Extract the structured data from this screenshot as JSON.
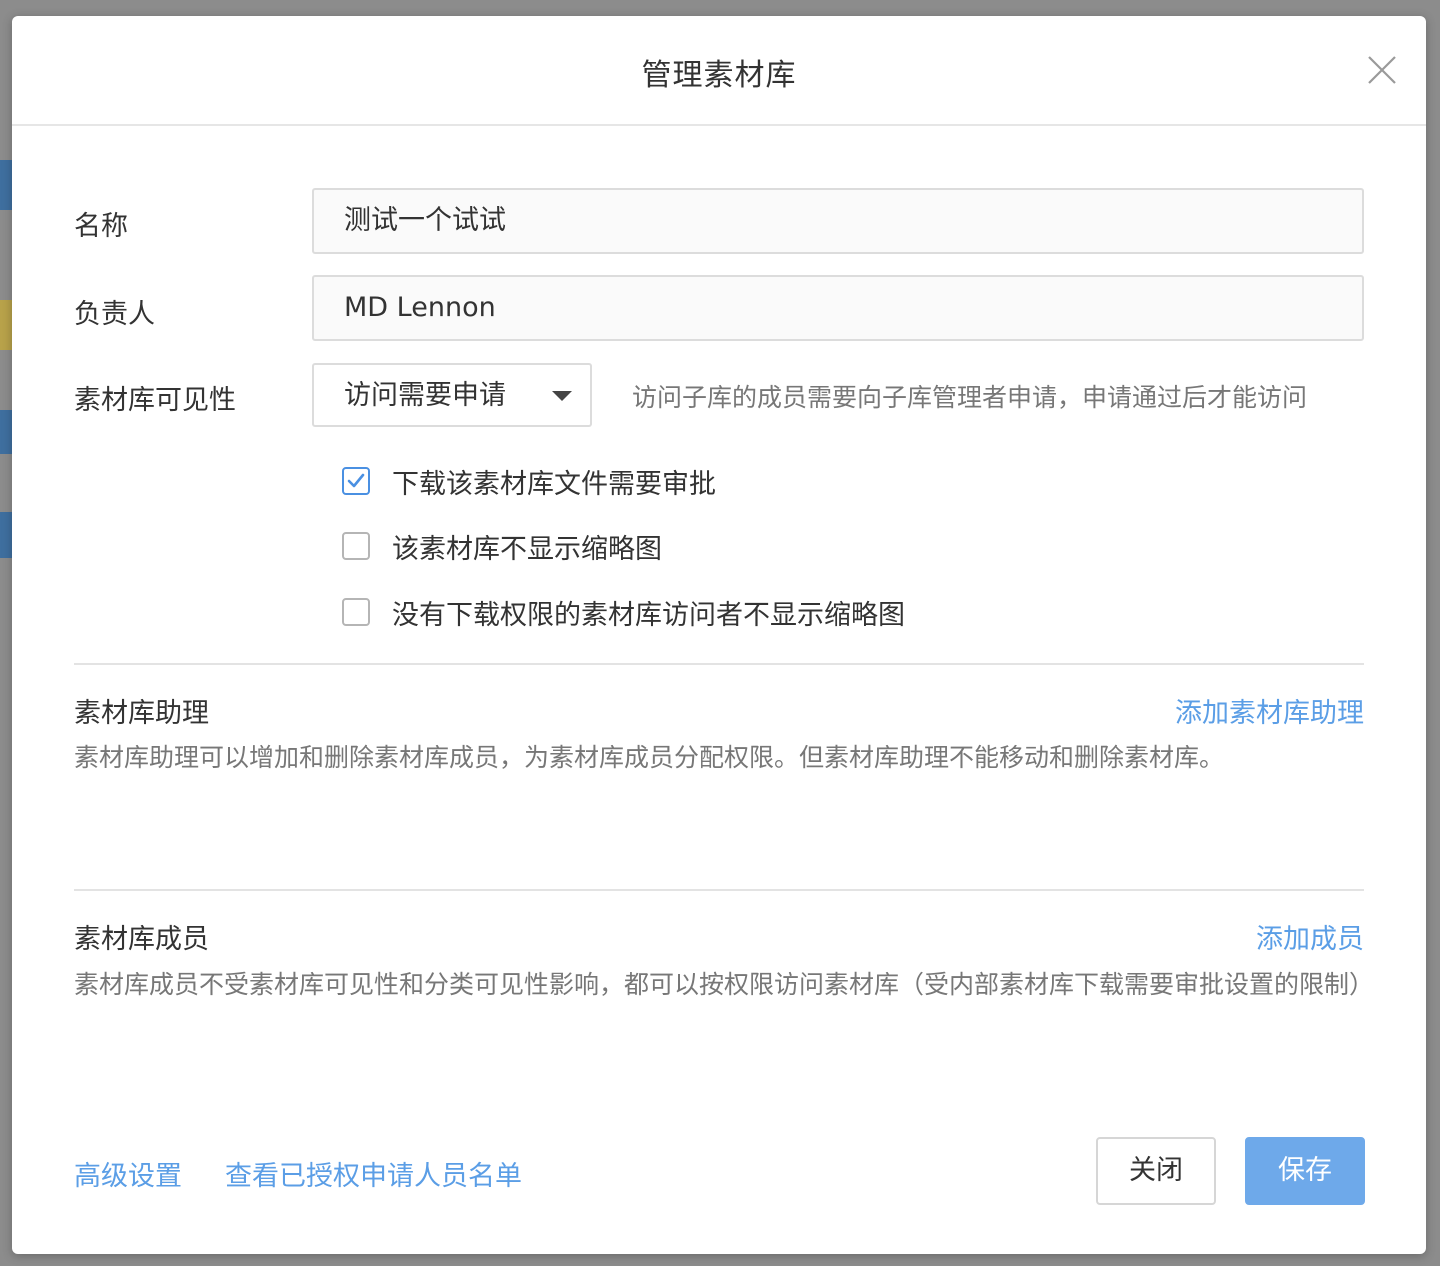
{
  "dialog": {
    "title": "管理素材库"
  },
  "form": {
    "name_label": "名称",
    "name_value": "测试一个试试",
    "owner_label": "负责人",
    "owner_value": "MD Lennon",
    "visibility_label": "素材库可见性",
    "visibility_selected": "访问需要申请",
    "visibility_hint": "访问子库的成员需要向子库管理者申请，申请通过后才能访问",
    "options": [
      {
        "label": "下载该素材库文件需要审批",
        "checked": true
      },
      {
        "label": "该素材库不显示缩略图",
        "checked": false
      },
      {
        "label": "没有下载权限的素材库访问者不显示缩略图",
        "checked": false
      }
    ]
  },
  "assistants": {
    "title": "素材库助理",
    "action": "添加素材库助理",
    "description": "素材库助理可以增加和删除素材库成员，为素材库成员分配权限。但素材库助理不能移动和删除素材库。"
  },
  "members": {
    "title": "素材库成员",
    "action": "添加成员",
    "description": "素材库成员不受素材库可见性和分类可见性影响，都可以按权限访问素材库（受内部素材库下载需要审批设置的限制）"
  },
  "footer": {
    "advanced_link": "高级设置",
    "view_applicants_link": "查看已授权申请人员名单",
    "close_button": "关闭",
    "save_button": "保存"
  },
  "colors": {
    "accent": "#5b9ee6",
    "primary_button": "#6ea9ea",
    "checkbox_checked": "#4a90e2"
  }
}
